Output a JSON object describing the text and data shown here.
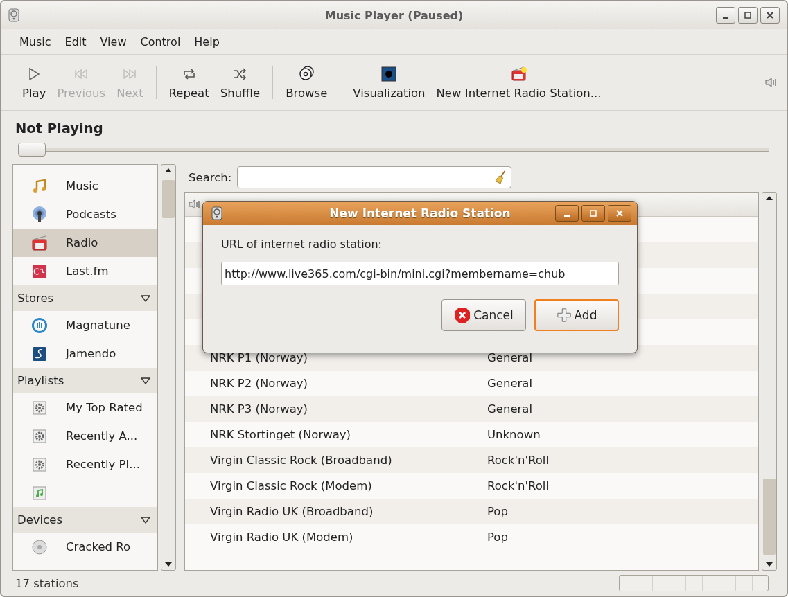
{
  "window": {
    "title": "Music Player (Paused)"
  },
  "menu": [
    "Music",
    "Edit",
    "View",
    "Control",
    "Help"
  ],
  "toolbar": {
    "groups": [
      [
        {
          "label": "Play",
          "disabled": false
        },
        {
          "label": "Previous",
          "disabled": true
        },
        {
          "label": "Next",
          "disabled": true
        }
      ],
      [
        {
          "label": "Repeat",
          "disabled": false
        },
        {
          "label": "Shuffle",
          "disabled": false
        }
      ],
      [
        {
          "label": "Browse",
          "disabled": false
        }
      ],
      [
        {
          "label": "Visualization",
          "disabled": false
        },
        {
          "label": "New Internet Radio Station...",
          "disabled": false
        }
      ]
    ]
  },
  "now_playing": {
    "title": "Not Playing"
  },
  "seek_slider": {
    "level": 0
  },
  "sidebar": {
    "items": [
      {
        "kind": "source",
        "label": "Music",
        "selected": false
      },
      {
        "kind": "source",
        "label": "Podcasts",
        "selected": false
      },
      {
        "kind": "source",
        "label": "Radio",
        "selected": true
      },
      {
        "kind": "source",
        "label": "Last.fm",
        "selected": false
      },
      {
        "kind": "header",
        "label": "Stores",
        "expanded": true
      },
      {
        "kind": "source",
        "label": "Magnatune",
        "selected": false
      },
      {
        "kind": "source",
        "label": "Jamendo",
        "selected": false
      },
      {
        "kind": "header",
        "label": "Playlists",
        "expanded": true
      },
      {
        "kind": "source",
        "label": "My Top Rated",
        "selected": false
      },
      {
        "kind": "source",
        "label": "Recently A...",
        "selected": false
      },
      {
        "kind": "source",
        "label": "Recently Pl...",
        "selected": false
      },
      {
        "kind": "source",
        "selected": false
      },
      {
        "kind": "header",
        "label": "Devices",
        "expanded": true
      },
      {
        "kind": "source",
        "label": "Cracked Ro",
        "selected": false
      }
    ]
  },
  "search": {
    "label": "Search:"
  },
  "table": {
    "rows": [
      {
        "title": "NRK P1 (Norway)",
        "genre": "General"
      },
      {
        "title": "NRK P2 (Norway)",
        "genre": "General"
      },
      {
        "title": "NRK P3 (Norway)",
        "genre": "General"
      },
      {
        "title": "NRK Stortinget (Norway)",
        "genre": "Unknown"
      },
      {
        "title": "Virgin Classic Rock (Broadband)",
        "genre": "Rock'n'Roll"
      },
      {
        "title": "Virgin Classic Rock (Modem)",
        "genre": "Rock'n'Roll"
      },
      {
        "title": "Virgin Radio UK (Broadband)",
        "genre": "Pop"
      },
      {
        "title": "Virgin Radio UK (Modem)",
        "genre": "Pop"
      }
    ]
  },
  "status_bar": {
    "text": "17 stations",
    "level": 0
  },
  "dialog": {
    "title": "New Internet Radio Station",
    "label": "URL of internet radio station:",
    "value": "http://www.live365.com/cgi-bin/mini.cgi?membername=chub",
    "buttons": [
      {
        "label": "Cancel",
        "default": false
      },
      {
        "label": "Add",
        "default": true
      }
    ]
  }
}
